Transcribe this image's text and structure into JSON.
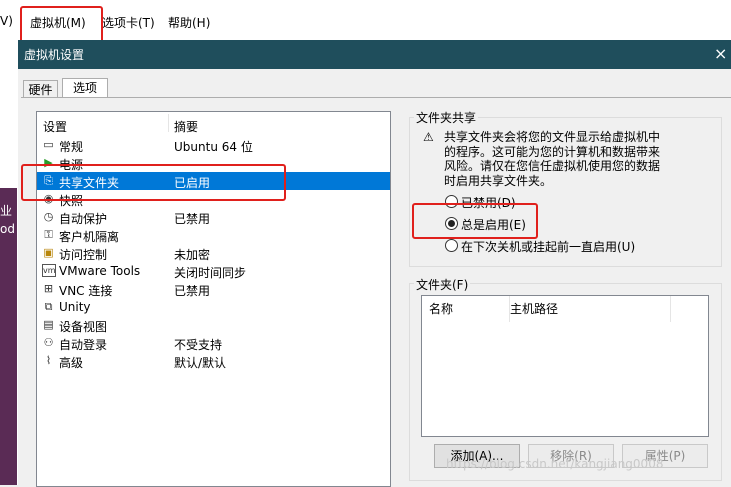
{
  "menubar": {
    "items": [
      {
        "label": "V)"
      },
      {
        "label": "虚拟机(M)"
      },
      {
        "label": "选项卡(T)"
      },
      {
        "label": "帮助(H)"
      }
    ]
  },
  "background_app": {
    "text_1": "业",
    "text_2": "od"
  },
  "dialog": {
    "title": "虚拟机设置",
    "close": "×",
    "tabs": [
      {
        "label": "硬件"
      },
      {
        "label": "选项"
      }
    ]
  },
  "settings_list": {
    "headers": {
      "setting": "设置",
      "summary": "摘要"
    },
    "rows": [
      {
        "icon": "monitor-icon",
        "name": "常规",
        "summary": "Ubuntu 64 位"
      },
      {
        "icon": "power-icon",
        "name": "电源",
        "summary": ""
      },
      {
        "icon": "shared-folder-icon",
        "name": "共享文件夹",
        "summary": "已启用"
      },
      {
        "icon": "snapshot-icon",
        "name": "快照",
        "summary": ""
      },
      {
        "icon": "autoprotect-icon",
        "name": "自动保护",
        "summary": "已禁用"
      },
      {
        "icon": "guest-isolation-icon",
        "name": "客户机隔离",
        "summary": ""
      },
      {
        "icon": "access-control-icon",
        "name": "访问控制",
        "summary": "未加密"
      },
      {
        "icon": "vmware-tools-icon",
        "name": "VMware Tools",
        "summary": "关闭时间同步"
      },
      {
        "icon": "vnc-icon",
        "name": "VNC 连接",
        "summary": "已禁用"
      },
      {
        "icon": "unity-icon",
        "name": "Unity",
        "summary": ""
      },
      {
        "icon": "device-view-icon",
        "name": "设备视图",
        "summary": ""
      },
      {
        "icon": "autologin-icon",
        "name": "自动登录",
        "summary": "不受支持"
      },
      {
        "icon": "advanced-icon",
        "name": "高级",
        "summary": "默认/默认"
      }
    ],
    "selected_index": 2
  },
  "folder_sharing": {
    "title": "文件夹共享",
    "warning": [
      "共享文件夹会将您的文件显示给虚拟机中",
      "的程序。这可能为您的计算机和数据带来",
      "风险。请仅在您信任虚拟机使用您的数据",
      "时启用共享文件夹。"
    ],
    "options": [
      {
        "label": "已禁用(D)",
        "checked": false
      },
      {
        "label": "总是启用(E)",
        "checked": true
      },
      {
        "label": "在下次关机或挂起前一直启用(U)",
        "checked": false
      }
    ]
  },
  "folders": {
    "title": "文件夹(F)",
    "columns": [
      "名称",
      "主机路径"
    ],
    "buttons": [
      {
        "label": "添加(A)...",
        "enabled": true
      },
      {
        "label": "移除(R)",
        "enabled": false
      },
      {
        "label": "属性(P)",
        "enabled": false
      }
    ]
  },
  "watermark": "https://blog.csdn.net/kangjiang0008"
}
